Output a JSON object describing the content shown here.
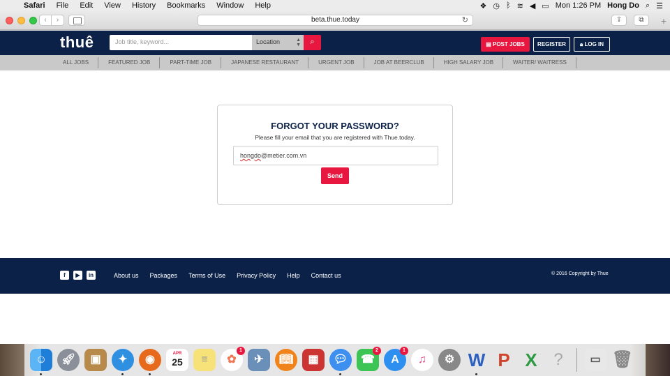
{
  "menubar": {
    "app": "Safari",
    "items": [
      "File",
      "Edit",
      "View",
      "History",
      "Bookmarks",
      "Window",
      "Help"
    ],
    "clock": "Mon 1:26 PM",
    "user": "Hong Do"
  },
  "browser": {
    "url": "beta.thue.today"
  },
  "site": {
    "logo": "thuê",
    "search_placeholder": "Job title, keyword...",
    "location_label": "Location",
    "post_jobs": "POST JOBS",
    "register": "REGISTER",
    "login": "LOG IN",
    "categories": [
      "ALL JOBS",
      "FEATURED JOB",
      "PART-TIME JOB",
      "JAPANESE RESTAURANT",
      "URGENT JOB",
      "JOB AT BEERCLUB",
      "HIGH SALARY JOB",
      "WAITER/ WAITRESS"
    ]
  },
  "forgot": {
    "title": "FORGOT YOUR PASSWORD?",
    "subtitle": "Please fill your email that you are registered with Thue.today.",
    "email_user": "hongdo",
    "email_domain": "@metier.com.vn",
    "send": "Send"
  },
  "footer": {
    "links": [
      "About us",
      "Packages",
      "Terms of Use",
      "Privacy Policy",
      "Help",
      "Contact us"
    ],
    "copyright": "© 2016 Copyright by Thue"
  },
  "dock": {
    "calendar_month": "APR",
    "calendar_day": "25",
    "badges": {
      "photos": "1",
      "facetime": "2",
      "appstore": "1"
    }
  }
}
